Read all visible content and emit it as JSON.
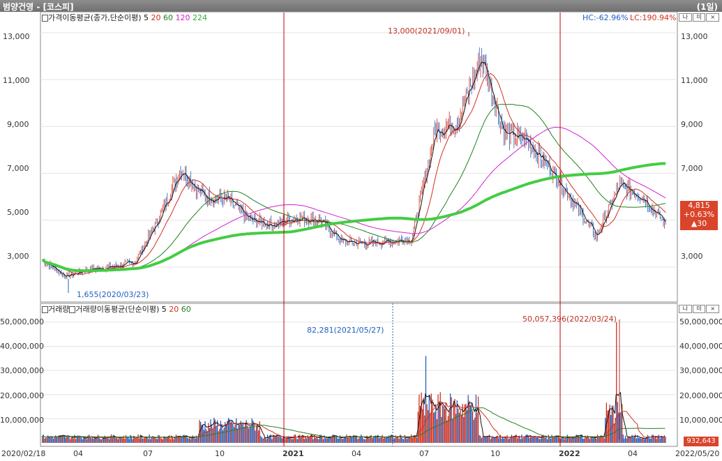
{
  "window": {
    "title": "범양건영 - [코스피]",
    "period": "(1일)"
  },
  "price_panel": {
    "legend_icon": "panel-toggle-icon",
    "legend_title": "가격이동평균(종가,단순이평)",
    "ma_periods": [
      {
        "label": "5",
        "color": "#111111"
      },
      {
        "label": "20",
        "color": "#d03020"
      },
      {
        "label": "60",
        "color": "#208020"
      },
      {
        "label": "120",
        "color": "#d020d0"
      },
      {
        "label": "224",
        "color": "#30b030"
      }
    ],
    "hc_text": "HC:-62.96%",
    "lc_text": "LC:190.94%",
    "high_annotation": "13,000(2021/09/01)",
    "low_annotation": "1,655(2020/03/23)",
    "y_ticks": [
      "13,000",
      "11,000",
      "9,000",
      "7,000",
      "5,000",
      "3,000"
    ],
    "y_ticks_right": [
      "13,000",
      "11,000",
      "9,000",
      "7,000",
      "5,000",
      "3,000"
    ],
    "current_price": "4,815",
    "change_pct": "+0.63%",
    "change_amt": "▲30",
    "controls": [
      "나",
      "미",
      "×"
    ]
  },
  "volume_panel": {
    "legend_title_a": "거래량",
    "legend_title_b": "거래량이동평균(단순이평)",
    "ma_periods": [
      {
        "label": "5",
        "color": "#111111"
      },
      {
        "label": "20",
        "color": "#d03020"
      },
      {
        "label": "60",
        "color": "#208020"
      }
    ],
    "max_annotation": "50,057,396(2022/03/24)",
    "min_annotation": "82,281(2021/05/27)",
    "y_ticks": [
      "50,000,000",
      "40,000,000",
      "30,000,000",
      "20,000,000",
      "10,000,000"
    ],
    "y_ticks_right": [
      "50,000,000",
      "40,000,000",
      "30,000,000",
      "20,000,000",
      "10,000,000"
    ],
    "current_volume": "932,643",
    "controls": [
      "나",
      "미",
      "×"
    ]
  },
  "x_axis": {
    "labels": [
      "2020/02/18",
      "04",
      "07",
      "10",
      "2021",
      "04",
      "07",
      "10",
      "2022",
      "04",
      "2022/05/20"
    ]
  },
  "colors": {
    "up": "#d03020",
    "down": "#2060c0",
    "ma224": "#44cc44",
    "divider": "#c00000"
  },
  "chart_data": {
    "type": "line",
    "title": "범양건영 - [코스피]",
    "x": [
      "2020/02",
      "2020/03",
      "2020/04",
      "2020/05",
      "2020/06",
      "2020/07",
      "2020/08",
      "2020/09",
      "2020/10",
      "2020/11",
      "2020/12",
      "2021/01",
      "2021/02",
      "2021/03",
      "2021/04",
      "2021/05",
      "2021/06",
      "2021/07",
      "2021/08",
      "2021/09",
      "2021/10",
      "2021/11",
      "2021/12",
      "2022/01",
      "2022/02",
      "2022/03",
      "2022/04",
      "2022/05"
    ],
    "series": [
      {
        "name": "",
        "values": [
          3300,
          2600,
          2900,
          3000,
          3200,
          5000,
          7200,
          6000,
          5900,
          5000,
          4800,
          5100,
          5000,
          4100,
          4000,
          4100,
          4200,
          8800,
          9200,
          12000,
          8700,
          8400,
          7200,
          5800,
          4300,
          6500,
          6000,
          4815
        ]
      }
    ],
    "ylim": [
      1600,
      13800
    ]
  }
}
